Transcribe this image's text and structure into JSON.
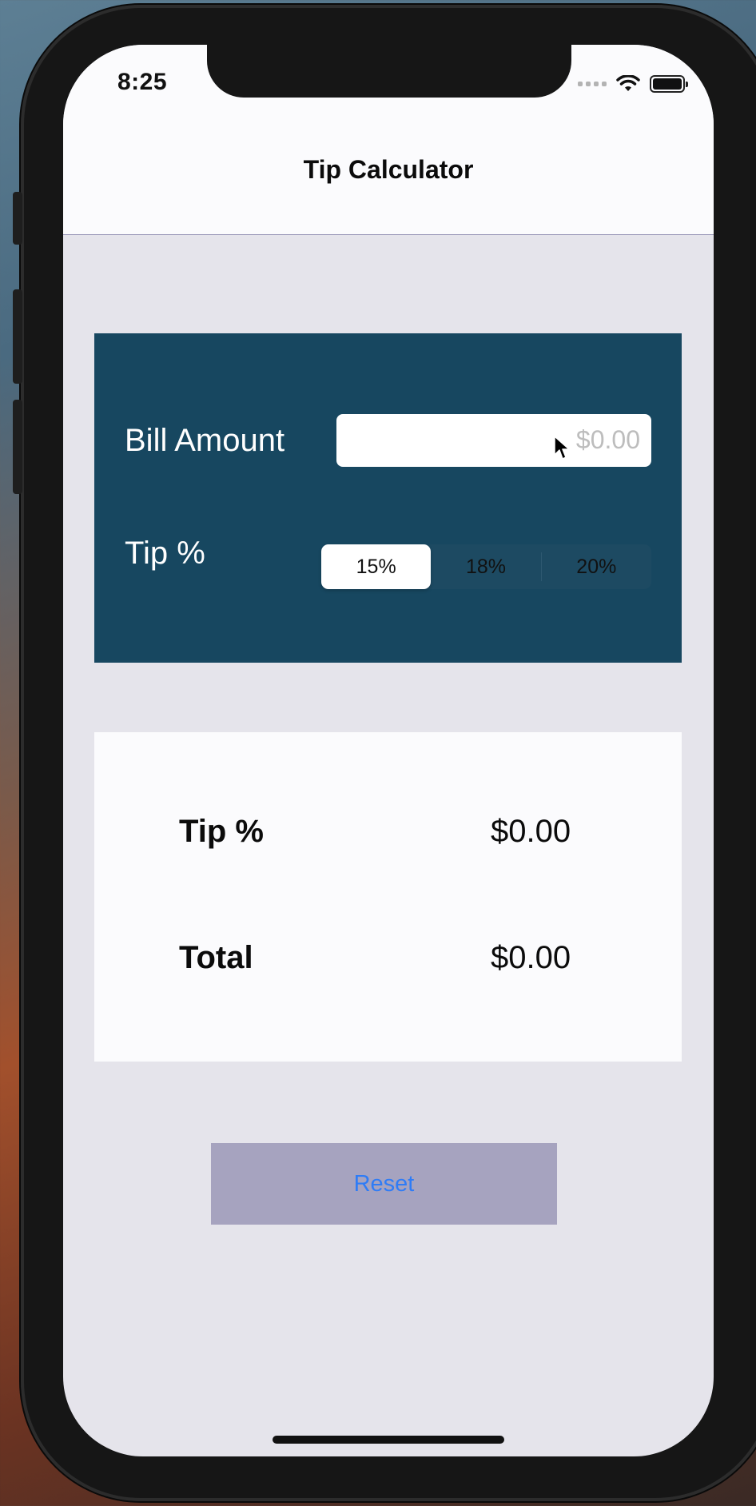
{
  "status_bar": {
    "time": "8:25",
    "icons": [
      "cellular-signal-icon",
      "wifi-icon",
      "battery-icon"
    ]
  },
  "nav": {
    "title": "Tip Calculator"
  },
  "input_panel": {
    "bill_label": "Bill Amount",
    "bill_placeholder": "$0.00",
    "tip_label": "Tip %",
    "tip_options": [
      "15%",
      "18%",
      "20%"
    ],
    "selected_tip": "15%"
  },
  "results": {
    "tip_label": "Tip %",
    "tip_value": "$0.00",
    "total_label": "Total",
    "total_value": "$0.00"
  },
  "actions": {
    "reset_label": "Reset"
  },
  "colors": {
    "input_panel_bg": "#174760",
    "results_bg": "#fbfbfd",
    "screen_bg": "#e5e4eb",
    "reset_bg": "#a6a3bf",
    "reset_text": "#2f7cf6"
  }
}
